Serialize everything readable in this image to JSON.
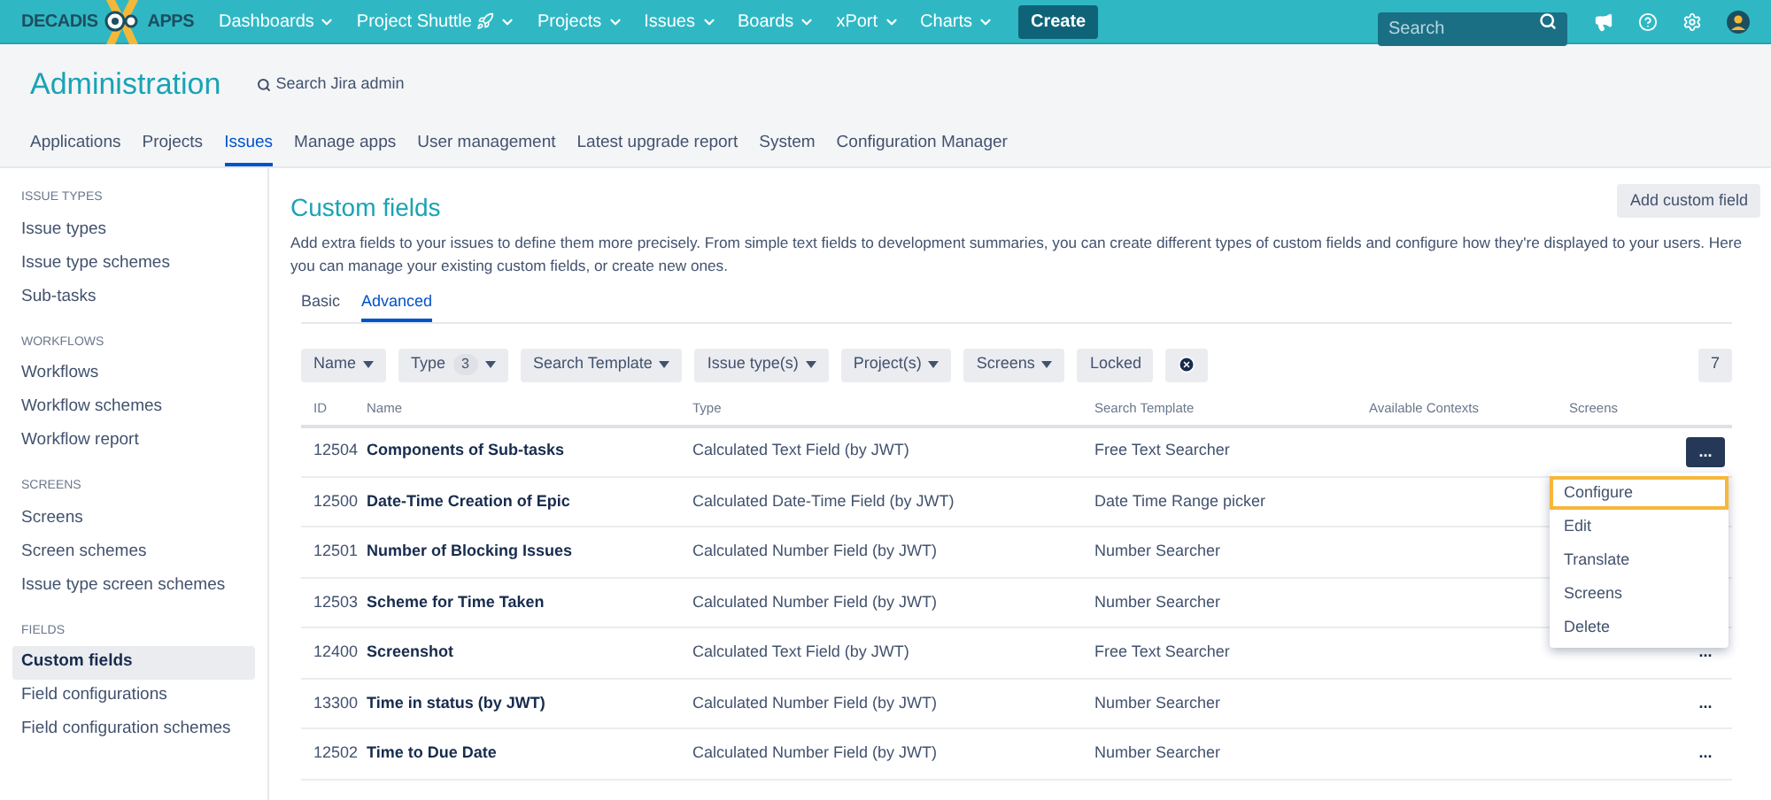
{
  "topbar": {
    "logo_left": "DECADIS",
    "logo_right": "APPS",
    "menu": [
      {
        "label": "Dashboards",
        "kind": "text"
      },
      {
        "label": "Project Shuttle",
        "kind": "with_icon"
      },
      {
        "label": "Projects",
        "kind": "text"
      },
      {
        "label": "Issues",
        "kind": "text"
      },
      {
        "label": "Boards",
        "kind": "text"
      },
      {
        "label": "xPort",
        "kind": "text"
      },
      {
        "label": "Charts",
        "kind": "text"
      }
    ],
    "create": "Create",
    "search": {
      "placeholder": "Search"
    }
  },
  "header": {
    "title": "Administration",
    "search_admin": "Search Jira admin",
    "tabs": [
      {
        "label": "Applications",
        "selected": false
      },
      {
        "label": "Projects",
        "selected": false
      },
      {
        "label": "Issues",
        "selected": true
      },
      {
        "label": "Manage apps",
        "selected": false
      },
      {
        "label": "User management",
        "selected": false
      },
      {
        "label": "Latest upgrade report",
        "selected": false
      },
      {
        "label": "System",
        "selected": false
      },
      {
        "label": "Configuration Manager",
        "selected": false
      }
    ]
  },
  "sidebar": [
    {
      "heading": "ISSUE TYPES",
      "items": [
        {
          "label": "Issue types",
          "selected": false
        },
        {
          "label": "Issue type schemes",
          "selected": false
        },
        {
          "label": "Sub-tasks",
          "selected": false
        }
      ]
    },
    {
      "heading": "WORKFLOWS",
      "items": [
        {
          "label": "Workflows",
          "selected": false
        },
        {
          "label": "Workflow schemes",
          "selected": false
        },
        {
          "label": "Workflow report",
          "selected": false
        }
      ]
    },
    {
      "heading": "SCREENS",
      "items": [
        {
          "label": "Screens",
          "selected": false
        },
        {
          "label": "Screen schemes",
          "selected": false
        },
        {
          "label": "Issue type screen schemes",
          "selected": false
        }
      ]
    },
    {
      "heading": "FIELDS",
      "items": [
        {
          "label": "Custom fields",
          "selected": true
        },
        {
          "label": "Field configurations",
          "selected": false
        },
        {
          "label": "Field configuration schemes",
          "selected": false
        }
      ]
    }
  ],
  "main": {
    "title": "Custom fields",
    "add_button": "Add custom field",
    "description": "Add extra fields to your issues to define them more precisely. From simple text fields to development summaries, you can create different types of custom fields and configure how they're displayed to your users. Here you can manage your existing custom fields, or create new ones.",
    "tabs": [
      {
        "label": "Basic",
        "selected": false
      },
      {
        "label": "Advanced",
        "selected": true
      }
    ],
    "filters": [
      {
        "kind": "dropdown",
        "label": "Name"
      },
      {
        "kind": "dropdown",
        "label": "Type",
        "badge": "3"
      },
      {
        "kind": "dropdown",
        "label": "Search Template"
      },
      {
        "kind": "dropdown",
        "label": "Issue type(s)"
      },
      {
        "kind": "dropdown",
        "label": "Project(s)"
      },
      {
        "kind": "dropdown",
        "label": "Screens"
      },
      {
        "kind": "toggle",
        "label": "Locked"
      },
      {
        "kind": "clear"
      }
    ],
    "count": "7",
    "table": {
      "columns": [
        "ID",
        "Name",
        "Type",
        "Search Template",
        "Available Contexts",
        "Screens"
      ],
      "rows": [
        {
          "id": "12504",
          "name": "Components of Sub-tasks",
          "type": "Calculated Text Field (by JWT)",
          "search_template": "Free Text Searcher",
          "actions": {
            "label": "...",
            "selected": true
          }
        },
        {
          "id": "12500",
          "name": "Date-Time Creation of Epic",
          "type": "Calculated Date-Time Field (by JWT)",
          "search_template": "Date Time Range picker"
        },
        {
          "id": "12501",
          "name": "Number of Blocking Issues",
          "type": "Calculated Number Field (by JWT)",
          "search_template": "Number Searcher"
        },
        {
          "id": "12503",
          "name": "Scheme for Time Taken",
          "type": "Calculated Number Field (by JWT)",
          "search_template": "Number Searcher"
        },
        {
          "id": "12400",
          "name": "Screenshot",
          "type": "Calculated Text Field (by JWT)",
          "search_template": "Free Text Searcher",
          "actions": {
            "label": "...",
            "selected": false
          }
        },
        {
          "id": "13300",
          "name": "Time in status (by JWT)",
          "type": "Calculated Number Field (by JWT)",
          "search_template": "Number Searcher",
          "actions": {
            "label": "...",
            "selected": false
          }
        },
        {
          "id": "12502",
          "name": "Time to Due Date",
          "type": "Calculated Number Field (by JWT)",
          "search_template": "Number Searcher",
          "actions": {
            "label": "...",
            "selected": false
          }
        }
      ]
    },
    "action_menu": [
      {
        "label": "Configure",
        "selected": true
      },
      {
        "label": "Edit",
        "selected": false
      },
      {
        "label": "Translate",
        "selected": false
      },
      {
        "label": "Screens",
        "selected": false
      },
      {
        "label": "Delete",
        "selected": false
      }
    ]
  }
}
